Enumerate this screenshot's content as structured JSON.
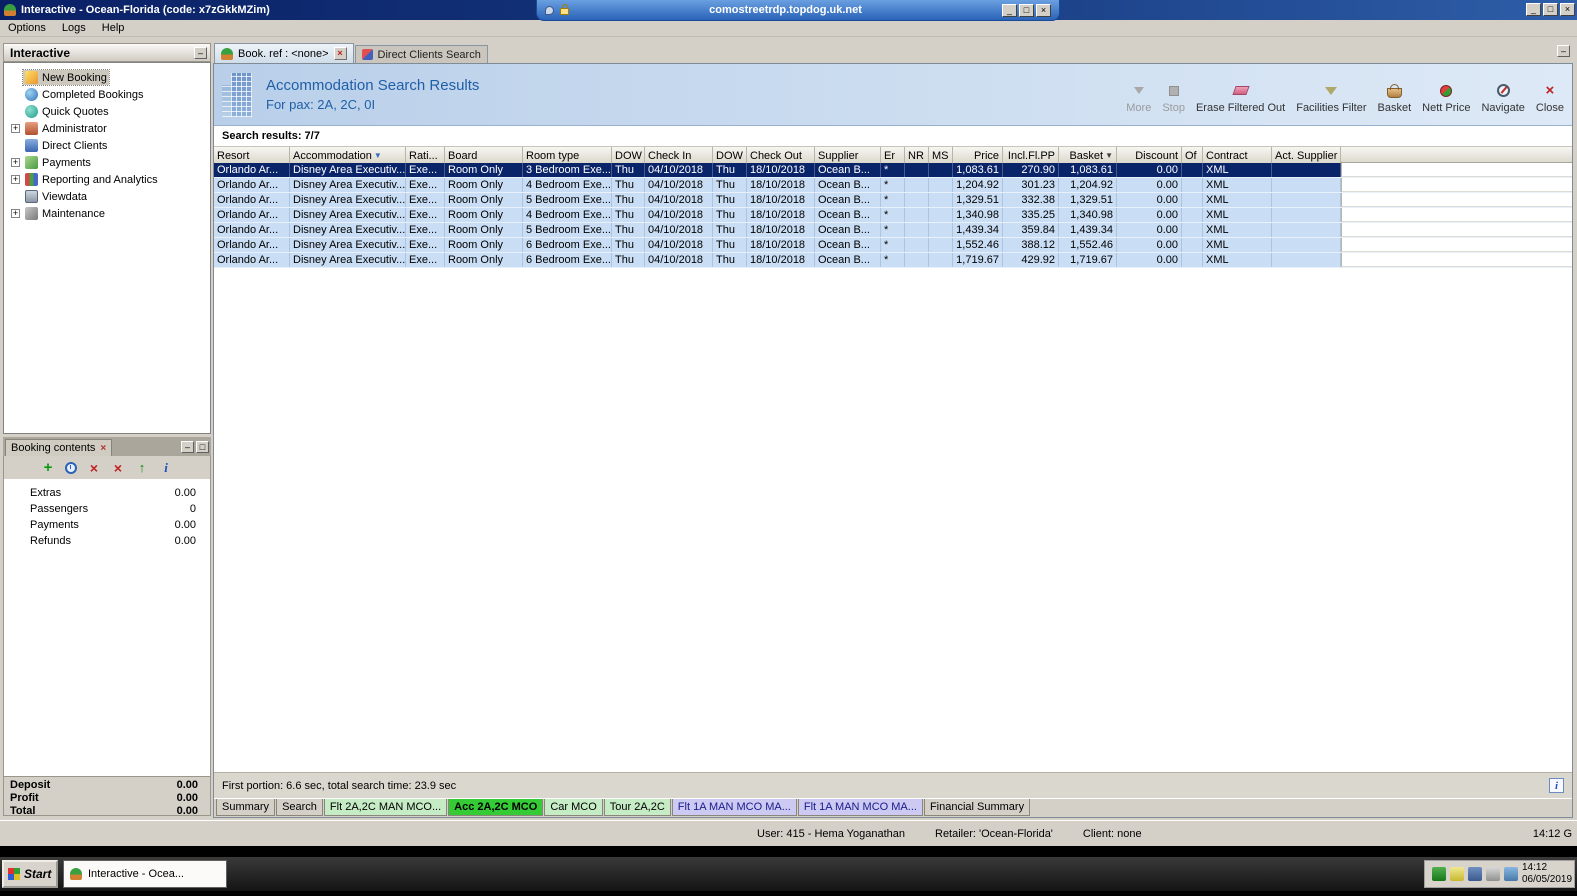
{
  "rdp": {
    "host": "comostreetrdp.topdog.uk.net"
  },
  "window": {
    "title": "Interactive - Ocean-Florida (code: x7zGkkMZim)"
  },
  "menubar": {
    "items": [
      "Options",
      "Logs",
      "Help"
    ]
  },
  "sidebar": {
    "title": "Interactive",
    "items": [
      {
        "label": "New Booking",
        "icon": "new-booking-icon",
        "expandable": false,
        "selected": true
      },
      {
        "label": "Completed Bookings",
        "icon": "completed-bookings-icon",
        "expandable": false,
        "selected": false
      },
      {
        "label": "Quick Quotes",
        "icon": "quick-quotes-icon",
        "expandable": false,
        "selected": false
      },
      {
        "label": "Administrator",
        "icon": "administrator-icon",
        "expandable": true,
        "selected": false
      },
      {
        "label": "Direct Clients",
        "icon": "direct-clients-icon",
        "expandable": false,
        "selected": false
      },
      {
        "label": "Payments",
        "icon": "payments-icon",
        "expandable": true,
        "selected": false
      },
      {
        "label": "Reporting and Analytics",
        "icon": "reporting-icon",
        "expandable": true,
        "selected": false
      },
      {
        "label": "Viewdata",
        "icon": "viewdata-icon",
        "expandable": false,
        "selected": false
      },
      {
        "label": "Maintenance",
        "icon": "maintenance-icon",
        "expandable": true,
        "selected": false
      }
    ]
  },
  "booking_contents": {
    "title": "Booking contents",
    "toolbar_icons": [
      "add-icon",
      "history-icon",
      "remove-all-icon",
      "delete-icon",
      "promote-icon",
      "info-icon"
    ],
    "rows": [
      {
        "label": "Extras",
        "value": "0.00"
      },
      {
        "label": "Passengers",
        "value": "0"
      },
      {
        "label": "Payments",
        "value": "0.00"
      },
      {
        "label": "Refunds",
        "value": "0.00"
      }
    ],
    "totals": [
      {
        "label": "Deposit",
        "value": "0.00"
      },
      {
        "label": "Profit",
        "value": "0.00"
      },
      {
        "label": "Total",
        "value": "0.00"
      }
    ]
  },
  "doc_tabs": [
    {
      "label": "Book. ref : <none>",
      "active": true,
      "closable": true
    },
    {
      "label": "Direct Clients Search",
      "active": false,
      "closable": false
    }
  ],
  "header": {
    "title": "Accommodation Search Results",
    "subtitle": "For pax: 2A, 2C, 0I",
    "toolbar": [
      {
        "label": "More",
        "icon": "more-icon",
        "disabled": true
      },
      {
        "label": "Stop",
        "icon": "stop-icon",
        "disabled": true
      },
      {
        "label": "Erase Filtered Out",
        "icon": "erase-icon",
        "disabled": false
      },
      {
        "label": "Facilities Filter",
        "icon": "facilities-icon",
        "disabled": false
      },
      {
        "label": "Basket",
        "icon": "basket-icon",
        "disabled": false
      },
      {
        "label": "Nett Price",
        "icon": "nett-icon",
        "disabled": false
      },
      {
        "label": "Navigate",
        "icon": "navigate-icon",
        "disabled": false
      },
      {
        "label": "Close",
        "icon": "close-icon",
        "disabled": false
      }
    ]
  },
  "results": {
    "summary": "Search results: 7/7",
    "footer": "First portion: 6.6 sec, total search time: 23.9 sec",
    "selected_row": 0,
    "columns": [
      {
        "label": "Resort"
      },
      {
        "label": "Accommodation",
        "filter": true
      },
      {
        "label": "Rati..."
      },
      {
        "label": "Board"
      },
      {
        "label": "Room type"
      },
      {
        "label": "DOW"
      },
      {
        "label": "Check In"
      },
      {
        "label": "DOW"
      },
      {
        "label": "Check Out"
      },
      {
        "label": "Supplier"
      },
      {
        "label": "Er"
      },
      {
        "label": "NR"
      },
      {
        "label": "MS"
      },
      {
        "label": "Price",
        "align": "right"
      },
      {
        "label": "Incl.Fl.PP",
        "align": "right"
      },
      {
        "label": "Basket",
        "align": "right",
        "sort": true
      },
      {
        "label": "Discount",
        "align": "right"
      },
      {
        "label": "Of"
      },
      {
        "label": "Contract"
      },
      {
        "label": "Act. Supplier"
      }
    ],
    "rows": [
      [
        "Orlando Ar...",
        "Disney Area Executiv...",
        "Exe...",
        "Room Only",
        "3 Bedroom Exe...",
        "Thu",
        "04/10/2018",
        "Thu",
        "18/10/2018",
        "Ocean B...",
        "*",
        "",
        "",
        "1,083.61",
        "270.90",
        "1,083.61",
        "0.00",
        "",
        "XML",
        ""
      ],
      [
        "Orlando Ar...",
        "Disney Area Executiv...",
        "Exe...",
        "Room Only",
        "4 Bedroom Exe...",
        "Thu",
        "04/10/2018",
        "Thu",
        "18/10/2018",
        "Ocean B...",
        "*",
        "",
        "",
        "1,204.92",
        "301.23",
        "1,204.92",
        "0.00",
        "",
        "XML",
        ""
      ],
      [
        "Orlando Ar...",
        "Disney Area Executiv...",
        "Exe...",
        "Room Only",
        "5 Bedroom Exe...",
        "Thu",
        "04/10/2018",
        "Thu",
        "18/10/2018",
        "Ocean B...",
        "*",
        "",
        "",
        "1,329.51",
        "332.38",
        "1,329.51",
        "0.00",
        "",
        "XML",
        ""
      ],
      [
        "Orlando Ar...",
        "Disney Area Executiv...",
        "Exe...",
        "Room Only",
        "4 Bedroom Exe...",
        "Thu",
        "04/10/2018",
        "Thu",
        "18/10/2018",
        "Ocean B...",
        "*",
        "",
        "",
        "1,340.98",
        "335.25",
        "1,340.98",
        "0.00",
        "",
        "XML",
        ""
      ],
      [
        "Orlando Ar...",
        "Disney Area Executiv...",
        "Exe...",
        "Room Only",
        "5 Bedroom Exe...",
        "Thu",
        "04/10/2018",
        "Thu",
        "18/10/2018",
        "Ocean B...",
        "*",
        "",
        "",
        "1,439.34",
        "359.84",
        "1,439.34",
        "0.00",
        "",
        "XML",
        ""
      ],
      [
        "Orlando Ar...",
        "Disney Area Executiv...",
        "Exe...",
        "Room Only",
        "6 Bedroom Exe...",
        "Thu",
        "04/10/2018",
        "Thu",
        "18/10/2018",
        "Ocean B...",
        "*",
        "",
        "",
        "1,552.46",
        "388.12",
        "1,552.46",
        "0.00",
        "",
        "XML",
        ""
      ],
      [
        "Orlando Ar...",
        "Disney Area Executiv...",
        "Exe...",
        "Room Only",
        "6 Bedroom Exe...",
        "Thu",
        "04/10/2018",
        "Thu",
        "18/10/2018",
        "Ocean B...",
        "*",
        "",
        "",
        "1,719.67",
        "429.92",
        "1,719.67",
        "0.00",
        "",
        "XML",
        ""
      ]
    ]
  },
  "bottom_tabs": [
    {
      "label": "Summary",
      "color": "gray",
      "active": false
    },
    {
      "label": "Search",
      "color": "gray",
      "active": false
    },
    {
      "label": "Flt 2A,2C MAN MCO...",
      "color": "green",
      "active": false
    },
    {
      "label": "Acc 2A,2C MCO",
      "color": "green-bright",
      "active": true
    },
    {
      "label": "Car MCO",
      "color": "green",
      "active": false
    },
    {
      "label": "Tour 2A,2C",
      "color": "green",
      "active": false
    },
    {
      "label": "Flt 1A MAN MCO MA...",
      "color": "purple",
      "active": false
    },
    {
      "label": "Flt 1A MAN MCO MA...",
      "color": "purple",
      "active": false
    },
    {
      "label": "Financial Summary",
      "color": "gray",
      "active": false
    }
  ],
  "statusbar": {
    "user": "User: 415 - Hema Yoganathan",
    "retailer": "Retailer: 'Ocean-Florida'",
    "client": "Client: none",
    "time": "14:12 G"
  },
  "taskbar": {
    "start": "Start",
    "task": "Interactive - Ocea...",
    "time": "14:12",
    "date": "06/05/2019"
  }
}
